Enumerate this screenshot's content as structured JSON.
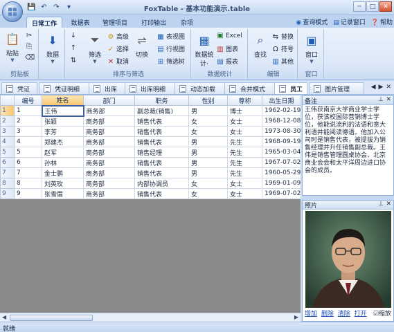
{
  "window": {
    "title": "FoxTable - 基本功能演示.table"
  },
  "qat": [
    "save-icon",
    "undo-icon",
    "redo-icon",
    "dropdown-icon"
  ],
  "ribbon_tabs": [
    {
      "label": "日常工作",
      "active": true
    },
    {
      "label": "数据表"
    },
    {
      "label": "管理项目"
    },
    {
      "label": "打印输出"
    },
    {
      "label": "杂项"
    }
  ],
  "modes": {
    "query_mode": "查询模式",
    "record_window": "记录窗口",
    "help": "帮助"
  },
  "groups": {
    "clipboard": {
      "label": "剪贴板",
      "paste": "粘贴"
    },
    "data": {
      "label": "数据"
    },
    "sort_filter": {
      "label": "排序与筛选",
      "filter": "筛选",
      "advanced": "高级",
      "select": "选择",
      "cancel": "取消",
      "switch": "切换",
      "table_view": "表视图",
      "row_view": "行视图",
      "filter_tree": "筛选树"
    },
    "stats": {
      "label": "数据统计",
      "data_stats": "数据统计·",
      "excel": "Excel",
      "chart": "图表",
      "report": "报表"
    },
    "edit": {
      "label": "编辑",
      "find": "查找",
      "replace": "替换",
      "symbol": "符号",
      "other": "其他"
    },
    "window": {
      "label": "窗口",
      "window": "窗口"
    }
  },
  "sheet_tabs": [
    "凭证",
    "凭证明细",
    "出库",
    "出库明细",
    "动态加载",
    "合并模式",
    "员工",
    "图片管理"
  ],
  "active_sheet": "员工",
  "grid": {
    "columns": [
      "编号",
      "姓名",
      "部门",
      "职务",
      "性别",
      "尊称",
      "出生日期"
    ],
    "rows": [
      [
        "1",
        "王伟",
        "商务部",
        "副总裁(销售)",
        "男",
        "博士",
        "1962-02-19"
      ],
      [
        "2",
        "张颖",
        "商务部",
        "销售代表",
        "女",
        "女士",
        "1968-12-08"
      ],
      [
        "3",
        "李芳",
        "商务部",
        "销售代表",
        "女",
        "女士",
        "1973-08-30"
      ],
      [
        "4",
        "郑建杰",
        "商务部",
        "销售代表",
        "男",
        "先生",
        "1968-09-19"
      ],
      [
        "5",
        "赵军",
        "商务部",
        "销售经理",
        "男",
        "先生",
        "1965-03-04"
      ],
      [
        "6",
        "孙林",
        "商务部",
        "销售代表",
        "男",
        "先生",
        "1967-07-02"
      ],
      [
        "7",
        "金士鹏",
        "商务部",
        "销售代表",
        "男",
        "先生",
        "1960-05-29"
      ],
      [
        "8",
        "刘英玫",
        "商务部",
        "内部协调员",
        "女",
        "女士",
        "1969-01-09"
      ],
      [
        "9",
        "张雪眉",
        "商务部",
        "销售代表",
        "女",
        "女士",
        "1969-07-02"
      ]
    ]
  },
  "notes": {
    "title": "备注",
    "text": "王伟获南京大学商业学士学位，获该校国际营销博士学位，他能说流利的法语和意大利语并能阅读德语。他加入公司时是销售代表，被提拔为销售经理并升任销售副总裁。王伟是销售管理圆桌协会、北京商业会会和太平洋周边进口协会的成员。"
  },
  "photo": {
    "title": "照片",
    "links": [
      "增加",
      "删除",
      "清除",
      "打开"
    ],
    "zoom_label": "缩放"
  },
  "status": "就绪",
  "colors": {
    "accent": "#c6d9f1",
    "selected_header": "#f7c56a"
  }
}
